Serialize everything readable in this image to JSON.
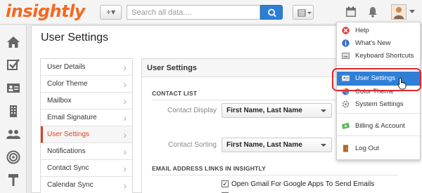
{
  "topbar": {
    "logo": "insightly",
    "add_label": "+▾",
    "search_placeholder": "Search all data...."
  },
  "page": {
    "title": "User Settings"
  },
  "settings_nav": [
    {
      "label": "User Details"
    },
    {
      "label": "Color Theme"
    },
    {
      "label": "Mailbox"
    },
    {
      "label": "Email Signature"
    },
    {
      "label": "User Settings"
    },
    {
      "label": "Notifications"
    },
    {
      "label": "Contact Sync"
    },
    {
      "label": "Calendar Sync"
    }
  ],
  "content": {
    "header": "User Settings",
    "contact_list_title": "CONTACT LIST",
    "contact_display_label": "Contact Display",
    "contact_display_value": "First Name, Last Name",
    "contact_sorting_label": "Contact Sorting",
    "contact_sorting_value": "First Name, Last Name",
    "email_links_title": "EMAIL ADDRESS LINKS IN INSIGHTLY",
    "gmail_option": "Open Gmail For Google Apps To Send Emails",
    "gmail_checked": true
  },
  "menu": {
    "items": [
      {
        "label": "Help",
        "icon": "help-icon"
      },
      {
        "label": "What's New",
        "icon": "info-icon"
      },
      {
        "label": "Keyboard Shortcuts",
        "icon": "keyboard-icon"
      },
      {
        "label": "User Settings",
        "icon": "id-card-icon"
      },
      {
        "label": "Color Theme",
        "icon": "palette-icon"
      },
      {
        "label": "System Settings",
        "icon": "gear-icon"
      },
      {
        "label": "Billing & Account",
        "icon": "money-icon"
      },
      {
        "label": "Log Out",
        "icon": "door-icon"
      }
    ]
  },
  "colors": {
    "brand": "#f26a21",
    "active_nav": "#e03e20",
    "menu_selected": "#2f7fd6",
    "highlight_ring": "#e5262b"
  }
}
